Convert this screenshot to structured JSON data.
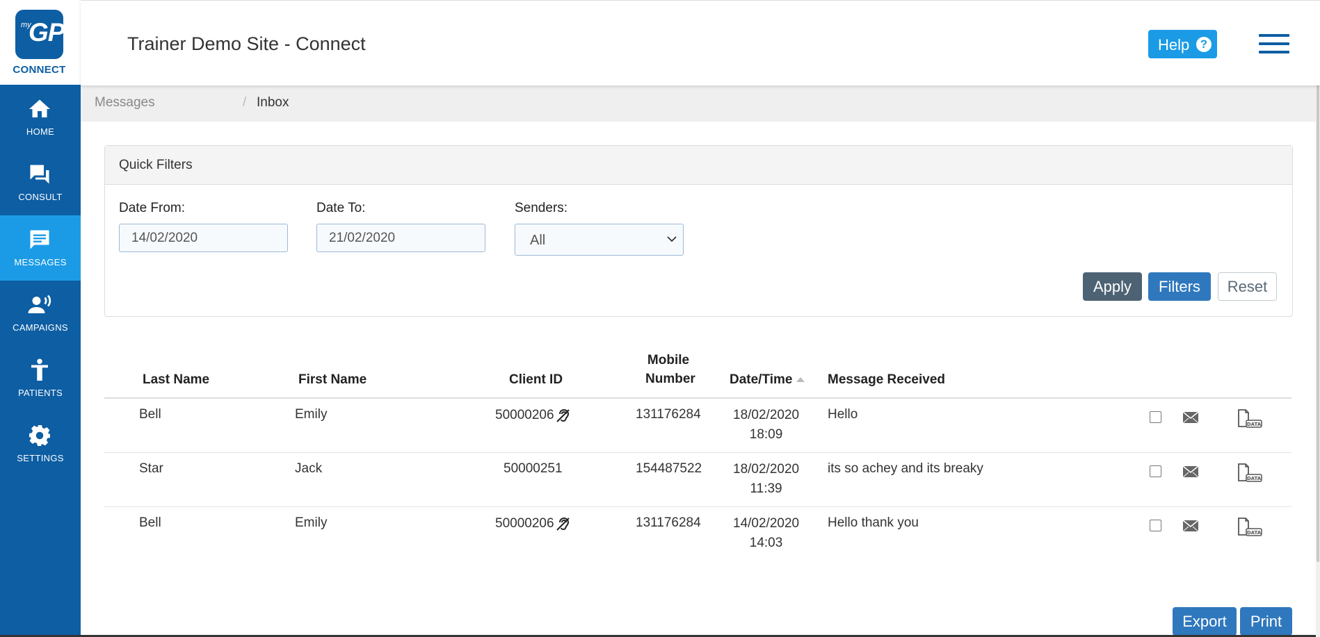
{
  "logo": {
    "my": "my",
    "gp": "GP",
    "connect": "CONNECT"
  },
  "sidebar": {
    "items": [
      {
        "label": "HOME",
        "icon": "home-icon"
      },
      {
        "label": "CONSULT",
        "icon": "chat-bubbles-icon"
      },
      {
        "label": "MESSAGES",
        "icon": "message-icon",
        "active": true
      },
      {
        "label": "CAMPAIGNS",
        "icon": "campaign-speaker-icon"
      },
      {
        "label": "PATIENTS",
        "icon": "person-icon"
      },
      {
        "label": "SETTINGS",
        "icon": "gear-icon"
      }
    ]
  },
  "header": {
    "title": "Trainer Demo Site - Connect",
    "help_label": "Help",
    "help_icon_glyph": "?"
  },
  "breadcrumb": {
    "parent": "Messages",
    "separator": "/",
    "current": "Inbox"
  },
  "filters": {
    "title": "Quick Filters",
    "date_from_label": "Date From:",
    "date_from_value": "14/02/2020",
    "date_to_label": "Date To:",
    "date_to_value": "21/02/2020",
    "senders_label": "Senders:",
    "senders_value": "All",
    "apply_label": "Apply",
    "filters_label": "Filters",
    "reset_label": "Reset"
  },
  "table": {
    "headers": {
      "last_name": "Last Name",
      "first_name": "First Name",
      "client_id": "Client ID",
      "mobile_line1": "Mobile",
      "mobile_line2": "Number",
      "datetime": "Date/Time",
      "message": "Message Received"
    },
    "rows": [
      {
        "last": "Bell",
        "first": "Emily",
        "client_id": "50000206",
        "hearing_icon": true,
        "mobile": "131176284",
        "date": "18/02/2020",
        "time": "18:09",
        "message": "Hello"
      },
      {
        "last": "Star",
        "first": "Jack",
        "client_id": "50000251",
        "hearing_icon": false,
        "mobile": "154487522",
        "date": "18/02/2020",
        "time": "11:39",
        "message": "its so achey and its breaky"
      },
      {
        "last": "Bell",
        "first": "Emily",
        "client_id": "50000206",
        "hearing_icon": true,
        "mobile": "131176284",
        "date": "14/02/2020",
        "time": "14:03",
        "message": "Hello thank you"
      }
    ]
  },
  "actions": {
    "export_label": "Export",
    "print_label": "Print"
  },
  "colors": {
    "brand": "#0d5ea3",
    "active_nav": "#1b9be6",
    "primary_button": "#2f78bd",
    "apply_button": "#4d6374"
  }
}
